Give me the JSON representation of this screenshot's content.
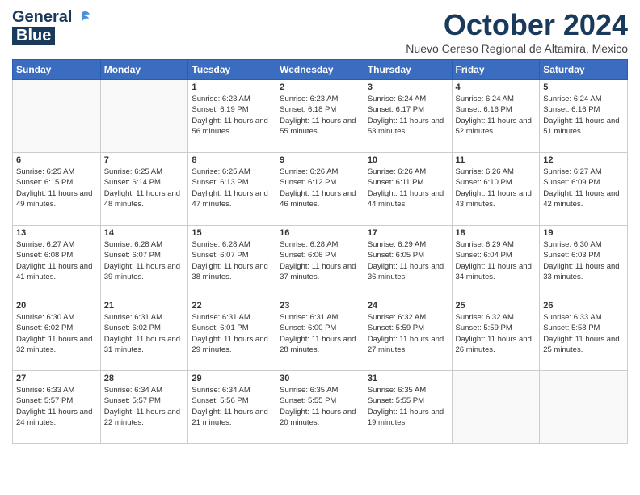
{
  "header": {
    "logo_general": "General",
    "logo_blue": "Blue",
    "month": "October 2024",
    "location": "Nuevo Cereso Regional de Altamira, Mexico"
  },
  "weekdays": [
    "Sunday",
    "Monday",
    "Tuesday",
    "Wednesday",
    "Thursday",
    "Friday",
    "Saturday"
  ],
  "weeks": [
    [
      {
        "day": "",
        "info": ""
      },
      {
        "day": "",
        "info": ""
      },
      {
        "day": "1",
        "info": "Sunrise: 6:23 AM\nSunset: 6:19 PM\nDaylight: 11 hours and 56 minutes."
      },
      {
        "day": "2",
        "info": "Sunrise: 6:23 AM\nSunset: 6:18 PM\nDaylight: 11 hours and 55 minutes."
      },
      {
        "day": "3",
        "info": "Sunrise: 6:24 AM\nSunset: 6:17 PM\nDaylight: 11 hours and 53 minutes."
      },
      {
        "day": "4",
        "info": "Sunrise: 6:24 AM\nSunset: 6:16 PM\nDaylight: 11 hours and 52 minutes."
      },
      {
        "day": "5",
        "info": "Sunrise: 6:24 AM\nSunset: 6:16 PM\nDaylight: 11 hours and 51 minutes."
      }
    ],
    [
      {
        "day": "6",
        "info": "Sunrise: 6:25 AM\nSunset: 6:15 PM\nDaylight: 11 hours and 49 minutes."
      },
      {
        "day": "7",
        "info": "Sunrise: 6:25 AM\nSunset: 6:14 PM\nDaylight: 11 hours and 48 minutes."
      },
      {
        "day": "8",
        "info": "Sunrise: 6:25 AM\nSunset: 6:13 PM\nDaylight: 11 hours and 47 minutes."
      },
      {
        "day": "9",
        "info": "Sunrise: 6:26 AM\nSunset: 6:12 PM\nDaylight: 11 hours and 46 minutes."
      },
      {
        "day": "10",
        "info": "Sunrise: 6:26 AM\nSunset: 6:11 PM\nDaylight: 11 hours and 44 minutes."
      },
      {
        "day": "11",
        "info": "Sunrise: 6:26 AM\nSunset: 6:10 PM\nDaylight: 11 hours and 43 minutes."
      },
      {
        "day": "12",
        "info": "Sunrise: 6:27 AM\nSunset: 6:09 PM\nDaylight: 11 hours and 42 minutes."
      }
    ],
    [
      {
        "day": "13",
        "info": "Sunrise: 6:27 AM\nSunset: 6:08 PM\nDaylight: 11 hours and 41 minutes."
      },
      {
        "day": "14",
        "info": "Sunrise: 6:28 AM\nSunset: 6:07 PM\nDaylight: 11 hours and 39 minutes."
      },
      {
        "day": "15",
        "info": "Sunrise: 6:28 AM\nSunset: 6:07 PM\nDaylight: 11 hours and 38 minutes."
      },
      {
        "day": "16",
        "info": "Sunrise: 6:28 AM\nSunset: 6:06 PM\nDaylight: 11 hours and 37 minutes."
      },
      {
        "day": "17",
        "info": "Sunrise: 6:29 AM\nSunset: 6:05 PM\nDaylight: 11 hours and 36 minutes."
      },
      {
        "day": "18",
        "info": "Sunrise: 6:29 AM\nSunset: 6:04 PM\nDaylight: 11 hours and 34 minutes."
      },
      {
        "day": "19",
        "info": "Sunrise: 6:30 AM\nSunset: 6:03 PM\nDaylight: 11 hours and 33 minutes."
      }
    ],
    [
      {
        "day": "20",
        "info": "Sunrise: 6:30 AM\nSunset: 6:02 PM\nDaylight: 11 hours and 32 minutes."
      },
      {
        "day": "21",
        "info": "Sunrise: 6:31 AM\nSunset: 6:02 PM\nDaylight: 11 hours and 31 minutes."
      },
      {
        "day": "22",
        "info": "Sunrise: 6:31 AM\nSunset: 6:01 PM\nDaylight: 11 hours and 29 minutes."
      },
      {
        "day": "23",
        "info": "Sunrise: 6:31 AM\nSunset: 6:00 PM\nDaylight: 11 hours and 28 minutes."
      },
      {
        "day": "24",
        "info": "Sunrise: 6:32 AM\nSunset: 5:59 PM\nDaylight: 11 hours and 27 minutes."
      },
      {
        "day": "25",
        "info": "Sunrise: 6:32 AM\nSunset: 5:59 PM\nDaylight: 11 hours and 26 minutes."
      },
      {
        "day": "26",
        "info": "Sunrise: 6:33 AM\nSunset: 5:58 PM\nDaylight: 11 hours and 25 minutes."
      }
    ],
    [
      {
        "day": "27",
        "info": "Sunrise: 6:33 AM\nSunset: 5:57 PM\nDaylight: 11 hours and 24 minutes."
      },
      {
        "day": "28",
        "info": "Sunrise: 6:34 AM\nSunset: 5:57 PM\nDaylight: 11 hours and 22 minutes."
      },
      {
        "day": "29",
        "info": "Sunrise: 6:34 AM\nSunset: 5:56 PM\nDaylight: 11 hours and 21 minutes."
      },
      {
        "day": "30",
        "info": "Sunrise: 6:35 AM\nSunset: 5:55 PM\nDaylight: 11 hours and 20 minutes."
      },
      {
        "day": "31",
        "info": "Sunrise: 6:35 AM\nSunset: 5:55 PM\nDaylight: 11 hours and 19 minutes."
      },
      {
        "day": "",
        "info": ""
      },
      {
        "day": "",
        "info": ""
      }
    ]
  ]
}
